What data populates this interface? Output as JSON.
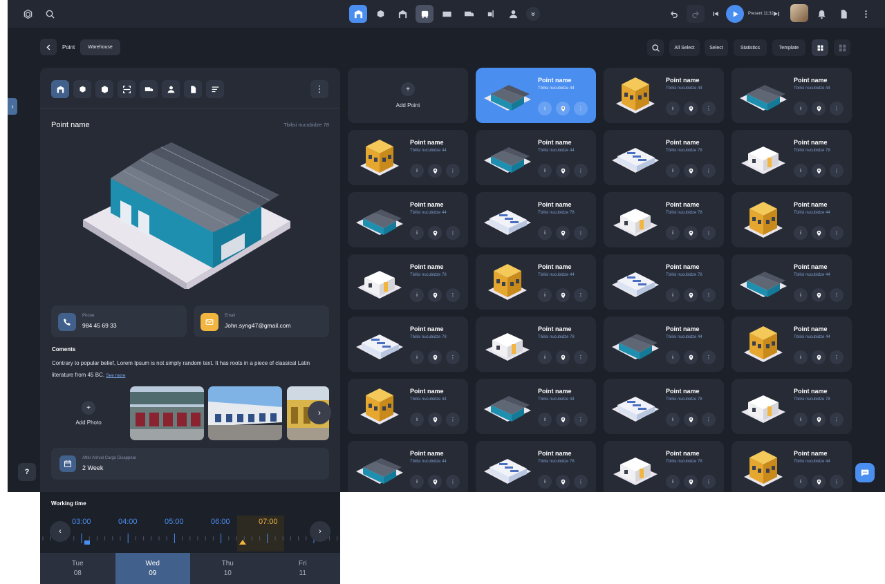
{
  "topbar": {
    "present_label": "Present 11:32"
  },
  "breadcrumb": {
    "point": "Point",
    "warehouse": "Warehouse"
  },
  "toolbar": {
    "all_select": "All Select",
    "select": "Select",
    "statistics": "Statistics",
    "template": "Template"
  },
  "detail": {
    "title": "Point name",
    "address": "Tbilisi nucubidze 78",
    "phone_label": "Phone",
    "phone": "984 45 69 33",
    "email_label": "Email",
    "email": "John.syng47@gmail.com",
    "comments_heading": "Coments",
    "comments_text": "Contrary to popular belief, Lorem Ipsum is not simply random text. It has roots in a piece of classical Latin literature from 45 BC.",
    "see_more": "See more",
    "add_photo": "Add Photo",
    "arrival_label": "After Arrival Cargo Disappear",
    "arrival_value": "2 Week"
  },
  "colors": {
    "accent": "#4a8ef0",
    "warning": "#f2b540",
    "bg": "#1c2029",
    "panel": "#262b36"
  },
  "grid": {
    "add_point": "Add Point",
    "cards": [
      {
        "name": "Point name",
        "addr": "Tbilisi nucubidze 44",
        "type": "warehouse",
        "selected": true
      },
      {
        "name": "Point name",
        "addr": "Tbilisi nucubidze 44",
        "type": "yellow"
      },
      {
        "name": "Point name",
        "addr": "Tbilisi nucubidze 44",
        "type": "warehouse"
      },
      {
        "name": "Point name",
        "addr": "Tbilisi nucubidze 44",
        "type": "yellow"
      },
      {
        "name": "Point name",
        "addr": "Tbilisi nucubidze 44",
        "type": "warehouse"
      },
      {
        "name": "Point name",
        "addr": "Tbilisi nucubidze 78",
        "type": "store"
      },
      {
        "name": "Point name",
        "addr": "Tbilisi nucubidze 78",
        "type": "shop"
      },
      {
        "name": "Point name",
        "addr": "Tbilisi nucubidze 44",
        "type": "warehouse"
      },
      {
        "name": "Point name",
        "addr": "Tbilisi nucubidze 78",
        "type": "store"
      },
      {
        "name": "Point name",
        "addr": "Tbilisi nucubidze 78",
        "type": "shop"
      },
      {
        "name": "Point name",
        "addr": "Tbilisi nucubidze 44",
        "type": "yellow"
      },
      {
        "name": "Point name",
        "addr": "Tbilisi nucubidze 78",
        "type": "shop"
      },
      {
        "name": "Point name",
        "addr": "Tbilisi nucubidze 44",
        "type": "yellow"
      },
      {
        "name": "Point name",
        "addr": "Tbilisi nucubidze 78",
        "type": "store"
      },
      {
        "name": "Point name",
        "addr": "Tbilisi nucubidze 44",
        "type": "warehouse"
      },
      {
        "name": "Point name",
        "addr": "Tbilisi nucubidze 78",
        "type": "store"
      },
      {
        "name": "Point name",
        "addr": "Tbilisi nucubidze 78",
        "type": "shop"
      },
      {
        "name": "Point name",
        "addr": "Tbilisi nucubidze 44",
        "type": "warehouse"
      },
      {
        "name": "Point name",
        "addr": "Tbilisi nucubidze 44",
        "type": "yellow"
      },
      {
        "name": "Point name",
        "addr": "Tbilisi nucubidze 44",
        "type": "yellow"
      },
      {
        "name": "Point name",
        "addr": "Tbilisi nucubidze 44",
        "type": "warehouse"
      },
      {
        "name": "Point name",
        "addr": "Tbilisi nucubidze 78",
        "type": "store"
      },
      {
        "name": "Point name",
        "addr": "Tbilisi nucubidze 78",
        "type": "shop"
      },
      {
        "name": "Point name",
        "addr": "Tbilisi nucubidze 44",
        "type": "warehouse"
      },
      {
        "name": "Point name",
        "addr": "Tbilisi nucubidze 78",
        "type": "store"
      },
      {
        "name": "Point name",
        "addr": "Tbilisi nucubidze 78",
        "type": "shop"
      },
      {
        "name": "Point name",
        "addr": "Tbilisi nucubidze 44",
        "type": "yellow"
      }
    ]
  },
  "working_time": {
    "heading": "Working time",
    "hours": [
      "03:00",
      "04:00",
      "05:00",
      "06:00",
      "07:00"
    ],
    "current_hour": "07:00",
    "days": [
      {
        "name": "Tue",
        "date": "08"
      },
      {
        "name": "Wed",
        "date": "09",
        "active": true
      },
      {
        "name": "Thu",
        "date": "10"
      },
      {
        "name": "Fri",
        "date": "11"
      }
    ]
  }
}
